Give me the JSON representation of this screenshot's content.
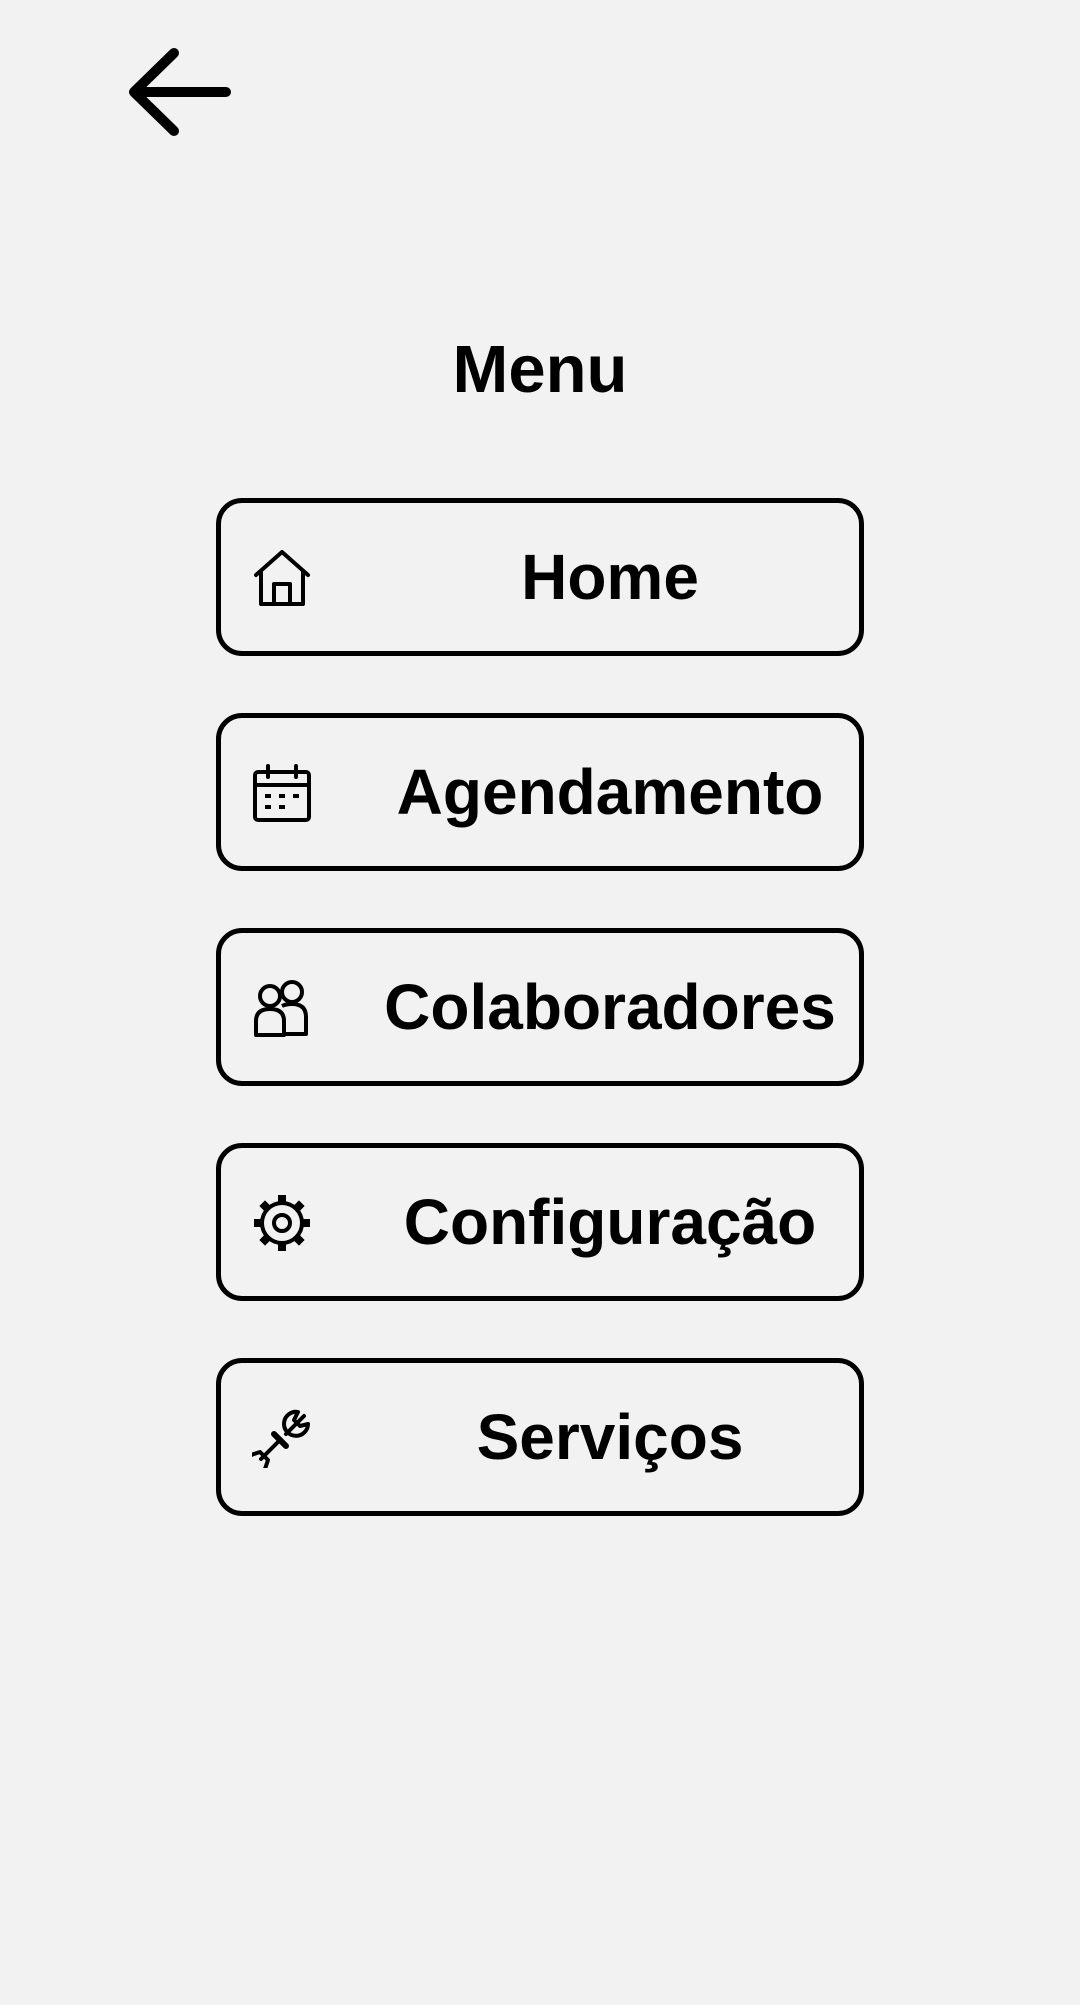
{
  "header": {
    "back_icon": "arrow-left-icon"
  },
  "title": "Menu",
  "menu": {
    "items": [
      {
        "label": "Home",
        "icon": "home-icon"
      },
      {
        "label": "Agendamento",
        "icon": "calendar-icon"
      },
      {
        "label": "Colaboradores",
        "icon": "users-icon"
      },
      {
        "label": "Configuração",
        "icon": "gear-icon"
      },
      {
        "label": "Serviços",
        "icon": "wrench-icon"
      }
    ]
  },
  "colors": {
    "background": "#f2f2f2",
    "foreground": "#000000"
  }
}
